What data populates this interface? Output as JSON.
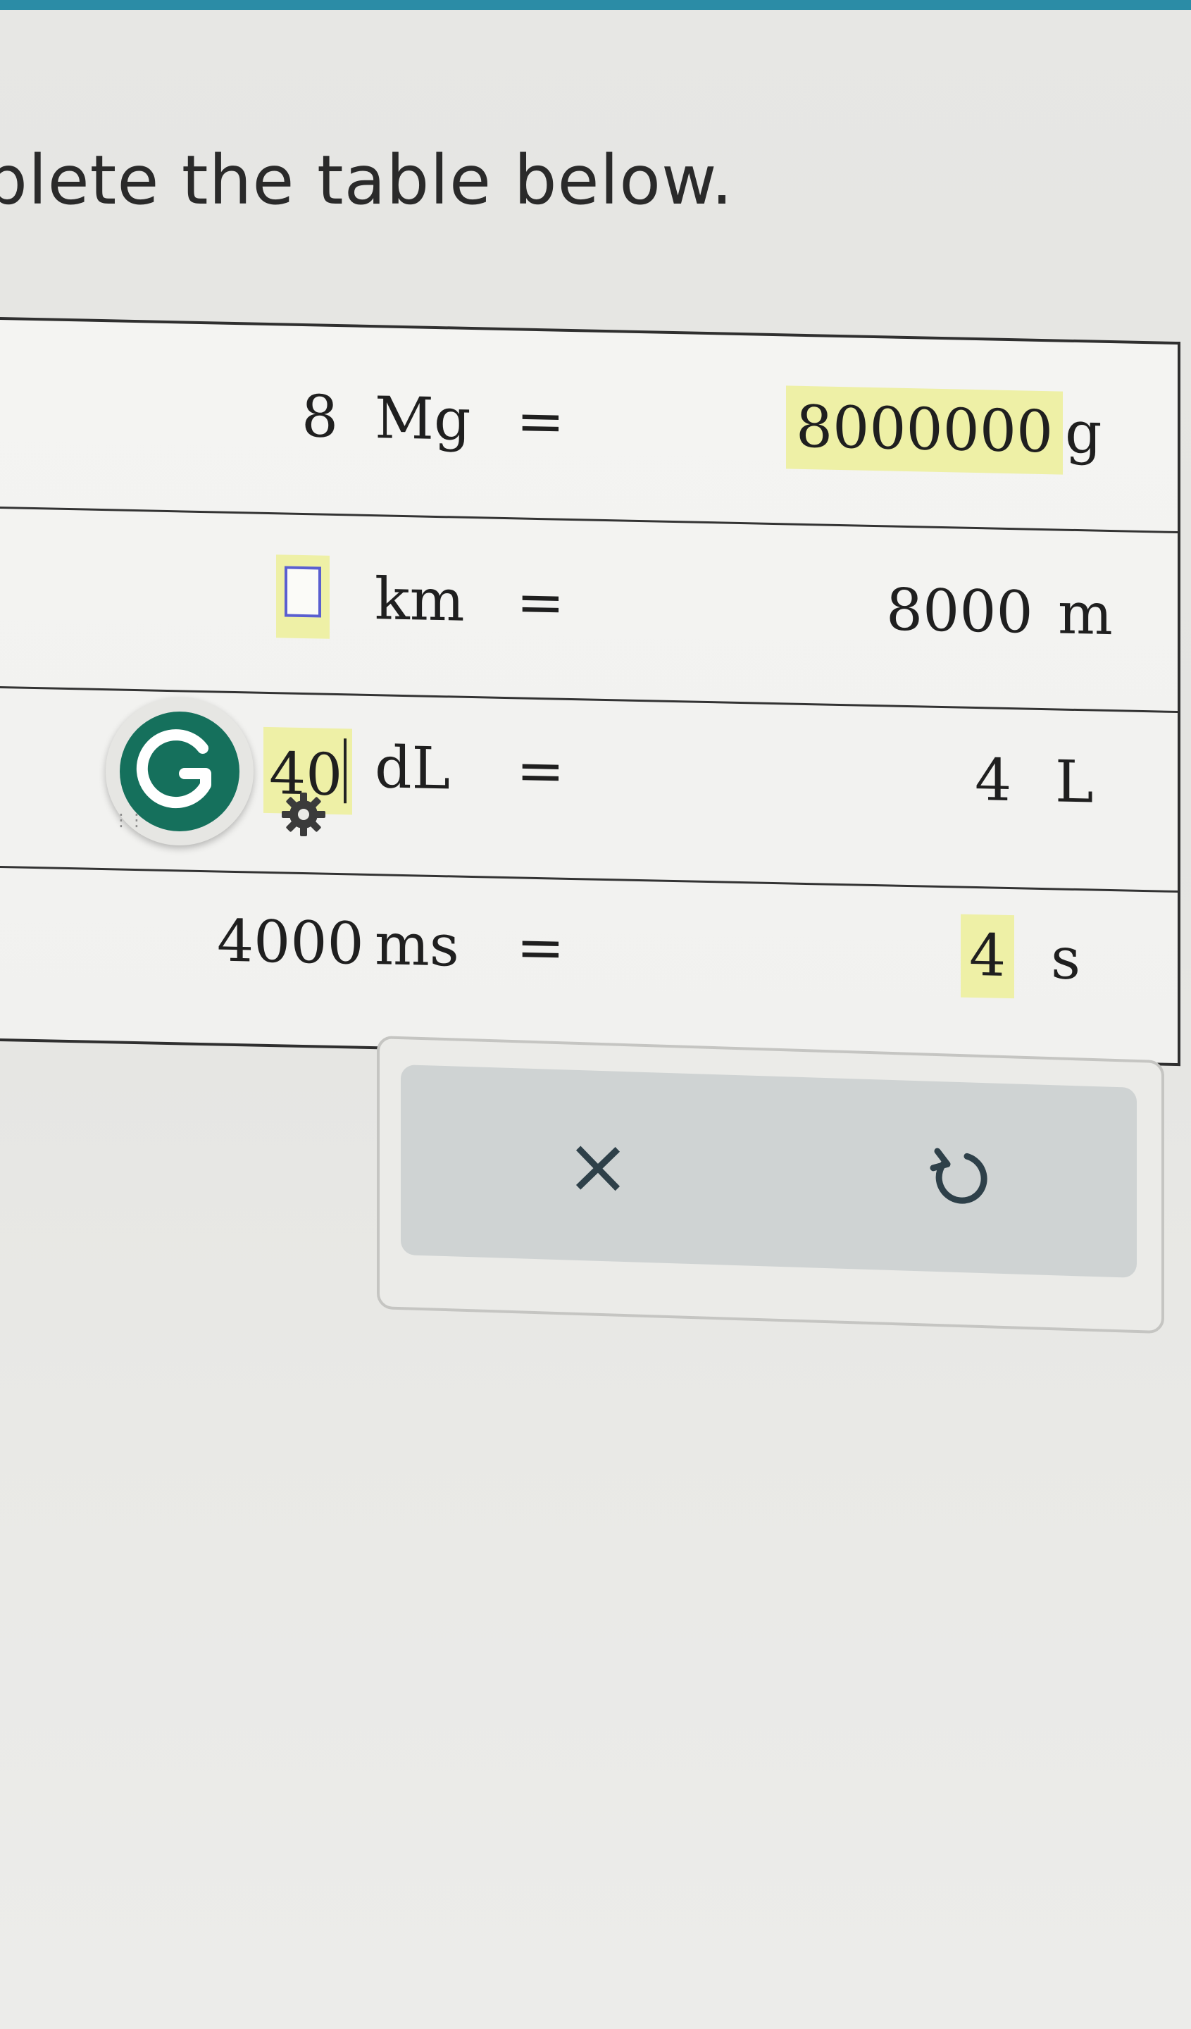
{
  "instruction": "plete the table below.",
  "colors": {
    "highlight": "#eef0a6",
    "accent_bar": "#2b8ca6",
    "grammarly": "#15705c"
  },
  "rows": [
    {
      "left_value": "8",
      "left_unit": "Mg",
      "equals": "=",
      "right_value": "8000000",
      "right_unit": "g"
    },
    {
      "left_value": "",
      "left_unit": "km",
      "equals": "=",
      "right_value": "8000",
      "right_unit": "m"
    },
    {
      "left_value": "40",
      "left_unit": "dL",
      "equals": "=",
      "right_value": "4",
      "right_unit": "L"
    },
    {
      "left_value": "4000",
      "left_unit": "ms",
      "equals": "=",
      "right_value": "4",
      "right_unit": "s"
    }
  ],
  "grammarly_badge": {
    "letter": "G",
    "icon": "grammarly-icon"
  },
  "settings_icon": "gear-icon",
  "toolbar": {
    "clear_symbol": "×",
    "clear_icon": "close-icon",
    "undo_icon": "undo-icon"
  }
}
